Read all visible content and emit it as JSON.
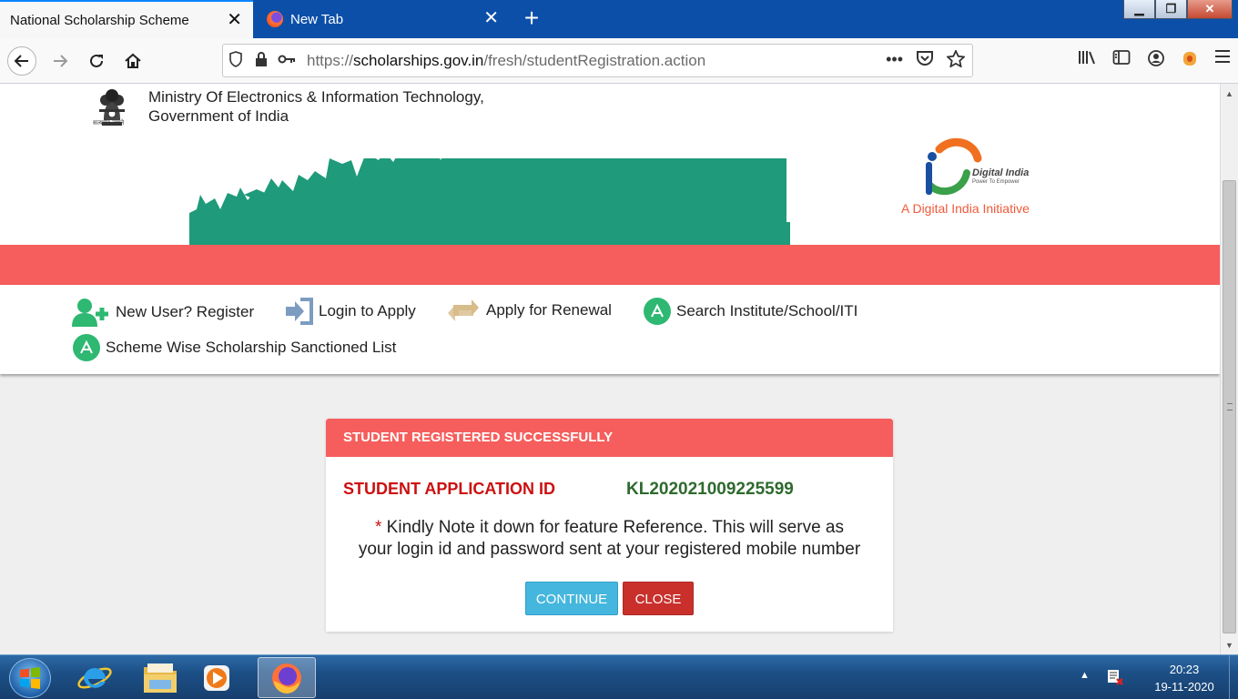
{
  "browser": {
    "tabs": [
      {
        "title": "National Scholarship Scheme",
        "active": true
      },
      {
        "title": "New Tab",
        "active": false
      }
    ],
    "new_tab_symbol": "+",
    "url_prefix": "https://",
    "url_domain": "scholarships.gov.in",
    "url_path": "/fresh/studentRegistration.action",
    "icons": {
      "back": "arrow-left-icon",
      "forward": "arrow-right-icon",
      "reload": "reload-icon",
      "home": "home-icon",
      "shield": "shield-icon",
      "lock": "lock-icon",
      "key": "key-icon",
      "more": "more-icon",
      "pocket": "pocket-icon",
      "bookmark": "star-icon",
      "library": "library-icon",
      "sidebar": "sidebar-icon",
      "account": "account-icon",
      "extension": "extension-icon",
      "menu": "hamburger-icon"
    }
  },
  "site": {
    "emblem_caption": "सत्यमेव जयते",
    "ministry_line1": "Ministry Of Electronics & Information Technology,",
    "ministry_line2": "Government of India",
    "digital_india_name": "Digital India",
    "digital_india_tagline": "Power To Empower",
    "digital_india_initiative": "A Digital India Initiative",
    "colors": {
      "red_band": "#f55e5c",
      "crowd_green": "#1f9a7a",
      "menu_green": "#2eb872"
    },
    "menu": [
      {
        "label": "New User? Register",
        "icon": "add-user-icon"
      },
      {
        "label": "Login to Apply",
        "icon": "login-icon"
      },
      {
        "label": "Apply for Renewal",
        "icon": "renewal-icon"
      },
      {
        "label": "Search Institute/School/ITI",
        "icon": "search-institute-icon"
      },
      {
        "label": "Scheme Wise Scholarship Sanctioned List",
        "icon": "sanctioned-list-icon"
      }
    ]
  },
  "dialog": {
    "title": "STUDENT REGISTERED SUCCESSFULLY",
    "app_id_label": "STUDENT APPLICATION ID",
    "app_id_value": "KL202021009225599",
    "note_star": "*",
    "note_line1": "Kindly Note it down for feature Reference. This will serve as",
    "note_line2": "your login id and password sent at your registered mobile number",
    "continue_label": "CONTINUE",
    "close_label": "CLOSE"
  },
  "taskbar": {
    "time": "20:23",
    "date": "19-11-2020",
    "apps": [
      "internet-explorer-icon",
      "file-explorer-icon",
      "media-player-icon",
      "firefox-icon"
    ]
  }
}
